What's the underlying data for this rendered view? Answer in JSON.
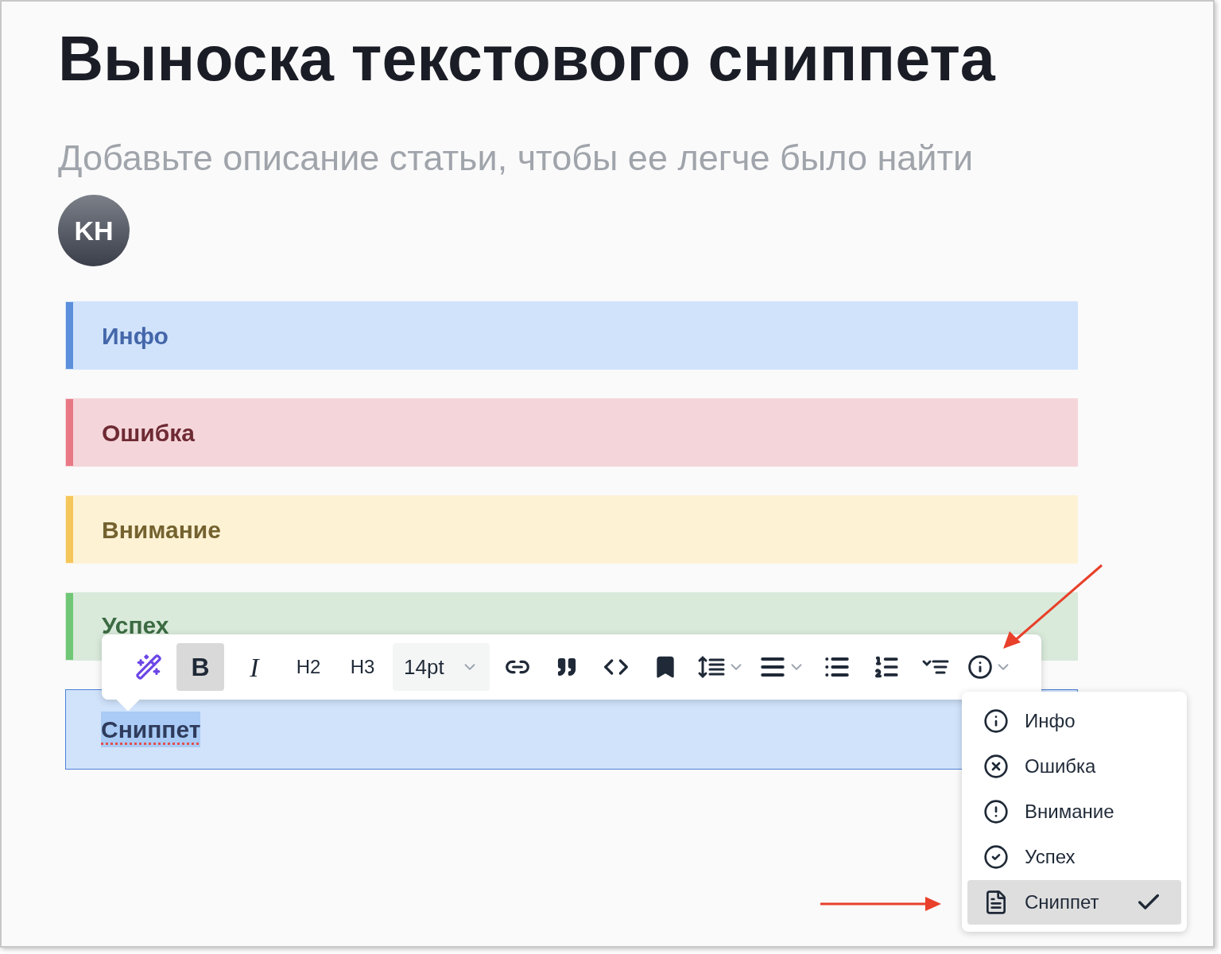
{
  "title": "Выноска текстового сниппета",
  "description_placeholder": "Добавьте описание статьи, чтобы ее легче было найти",
  "avatar": {
    "initials": "KH"
  },
  "callouts": [
    {
      "kind": "info",
      "text": "Инфо",
      "focused": false,
      "text_selected": false
    },
    {
      "kind": "error",
      "text": "Ошибка",
      "focused": false,
      "text_selected": false
    },
    {
      "kind": "warning",
      "text": "Внимание",
      "focused": false,
      "text_selected": false
    },
    {
      "kind": "success",
      "text": "Успех",
      "focused": false,
      "text_selected": false
    },
    {
      "kind": "snippet",
      "text": "Сниппет",
      "focused": true,
      "text_selected": true
    }
  ],
  "toolbar": [
    {
      "kind": "icon",
      "selected": false,
      "dropdown": false
    },
    {
      "kind": "text",
      "label": "B",
      "selected": true,
      "dropdown": false
    },
    {
      "kind": "text",
      "label": "I",
      "selected": false,
      "dropdown": false
    },
    {
      "kind": "text",
      "label": "H2",
      "selected": false,
      "dropdown": false
    },
    {
      "kind": "text",
      "label": "H3",
      "selected": false,
      "dropdown": false
    },
    {
      "kind": "select",
      "label": "14pt",
      "selected": false,
      "dropdown": true
    },
    {
      "kind": "icon",
      "selected": false,
      "dropdown": false
    },
    {
      "kind": "icon",
      "selected": false,
      "dropdown": false
    },
    {
      "kind": "icon",
      "selected": false,
      "dropdown": false
    },
    {
      "kind": "icon",
      "selected": false,
      "dropdown": false
    },
    {
      "kind": "icon",
      "selected": false,
      "dropdown": true
    },
    {
      "kind": "icon",
      "selected": false,
      "dropdown": true
    },
    {
      "kind": "icon",
      "selected": false,
      "dropdown": false
    },
    {
      "kind": "icon",
      "selected": false,
      "dropdown": false
    },
    {
      "kind": "icon",
      "selected": false,
      "dropdown": false
    },
    {
      "kind": "icon",
      "selected": false,
      "dropdown": true
    }
  ],
  "callout_menu": [
    {
      "label": "Инфо",
      "selected": false
    },
    {
      "label": "Ошибка",
      "selected": false
    },
    {
      "label": "Внимание",
      "selected": false
    },
    {
      "label": "Успех",
      "selected": false
    },
    {
      "label": "Сниппет",
      "selected": true
    }
  ]
}
